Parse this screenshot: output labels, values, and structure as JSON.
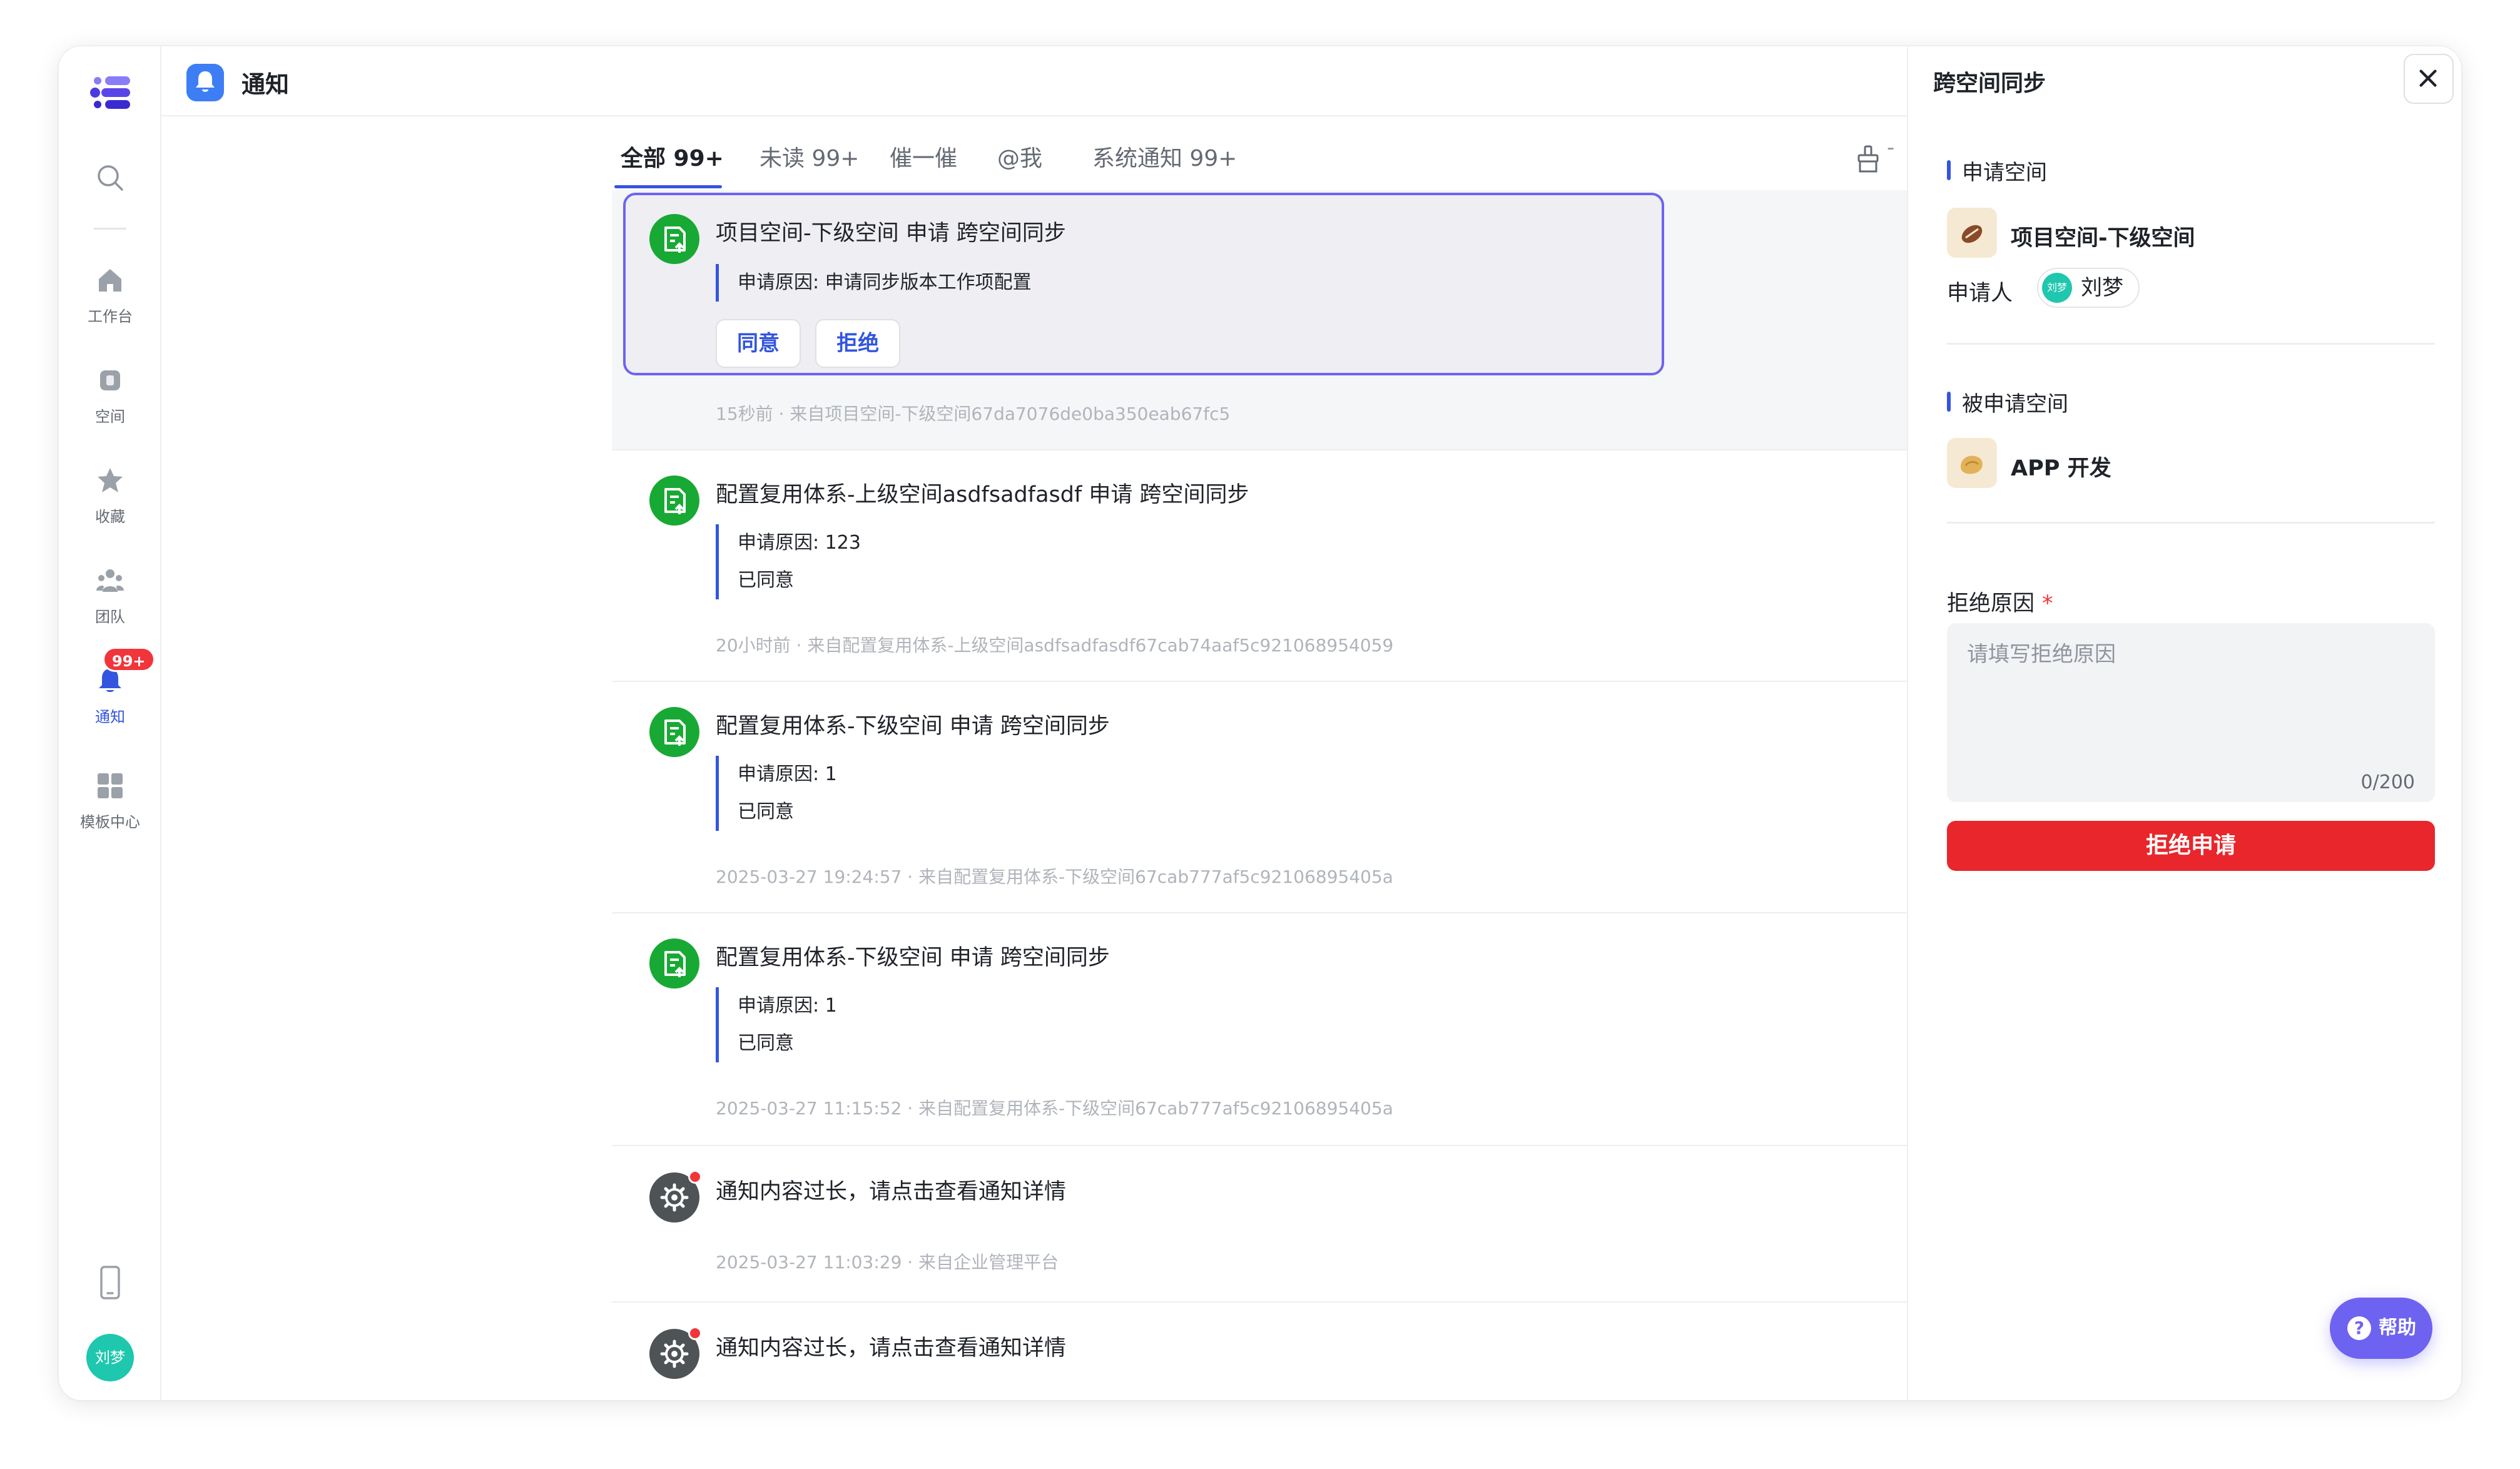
{
  "header": {
    "title": "通知"
  },
  "sidebar": {
    "items": [
      {
        "label": "工作台",
        "icon": "home-icon"
      },
      {
        "label": "空间",
        "icon": "space-icon"
      },
      {
        "label": "收藏",
        "icon": "star-icon"
      },
      {
        "label": "团队",
        "icon": "team-icon"
      },
      {
        "label": "通知",
        "icon": "bell-icon",
        "badge": "99+",
        "active": true
      },
      {
        "label": "模板中心",
        "icon": "template-icon"
      }
    ],
    "avatar_text": "刘梦"
  },
  "tabs": [
    {
      "label": "全部 99+",
      "active": true
    },
    {
      "label": "未读 99+"
    },
    {
      "label": "催一催"
    },
    {
      "label": "@我"
    },
    {
      "label": "系统通知 99+"
    }
  ],
  "notifications": [
    {
      "title": "项目空间-下级空间 申请 跨空间同步",
      "reason": "申请原因: 申请同步版本工作项配置",
      "actions": [
        "同意",
        "拒绝"
      ],
      "meta": "15秒前 · 来自项目空间-下级空间67da7076de0ba350eab67fc5"
    },
    {
      "title": "配置复用体系-上级空间asdfsadfasdf 申请 跨空间同步",
      "reason": "申请原因: 123",
      "status": "已同意",
      "meta": "20小时前 · 来自配置复用体系-上级空间asdfsadfasdf67cab74aaf5c921068954059"
    },
    {
      "title": "配置复用体系-下级空间 申请 跨空间同步",
      "reason": "申请原因: 1",
      "status": "已同意",
      "meta": "2025-03-27 19:24:57 · 来自配置复用体系-下级空间67cab777af5c92106895405a"
    },
    {
      "title": "配置复用体系-下级空间 申请 跨空间同步",
      "reason": "申请原因: 1",
      "status": "已同意",
      "meta": "2025-03-27 11:15:52 · 来自配置复用体系-下级空间67cab777af5c92106895405a"
    },
    {
      "title": "通知内容过长，请点击查看通知详情",
      "meta": "2025-03-27 11:03:29 · 来自企业管理平台"
    },
    {
      "title": "通知内容过长，请点击查看通知详情"
    }
  ],
  "drawer": {
    "title": "跨空间同步",
    "apply_space_label": "申请空间",
    "apply_space_name": "项目空间-下级空间",
    "applicant_label": "申请人",
    "applicant_name": "刘梦",
    "applicant_avatar_text": "刘梦",
    "target_space_label": "被申请空间",
    "target_space_name": "APP 开发",
    "reject_reason_label": "拒绝原因",
    "required_mark": "*",
    "reject_reason_placeholder": "请填写拒绝原因",
    "char_count": "0/200",
    "reject_button": "拒绝申请"
  },
  "help": {
    "label": "帮助",
    "icon_text": "?"
  },
  "colors": {
    "accent": "#3355e0",
    "success": "#18a934",
    "danger": "#e8262b",
    "help": "#6e63f0"
  }
}
